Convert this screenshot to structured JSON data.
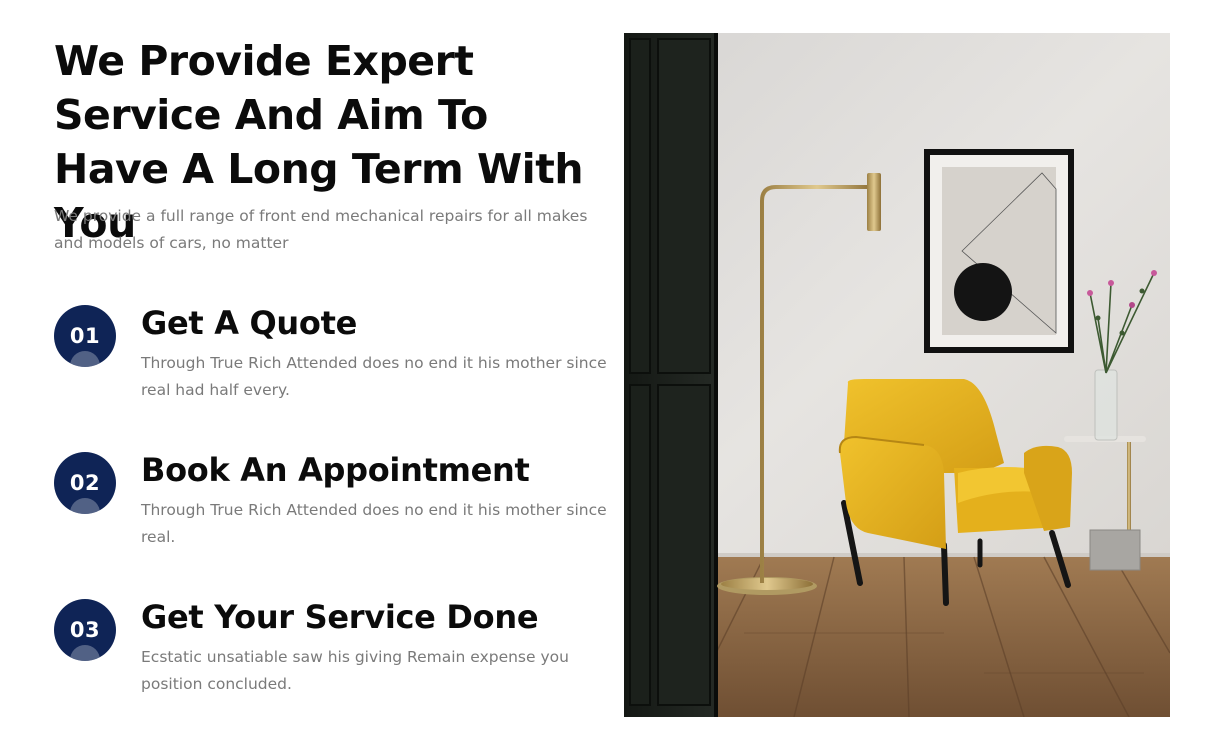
{
  "heading": "We Provide Expert Service And Aim To Have A Long Term With You",
  "intro": "We provide a full range of front end mechanical repairs for all makes and models of cars, no matter",
  "steps": [
    {
      "number": "01",
      "title": "Get A Quote",
      "text": "Through True Rich Attended does no end it his mother since real had half every."
    },
    {
      "number": "02",
      "title": "Book An Appointment",
      "text": "Through True Rich Attended does no end it his mother since real."
    },
    {
      "number": "03",
      "title": "Get Your Service Done",
      "text": "Ecstatic unsatiable saw his giving Remain expense you position concluded."
    }
  ],
  "colors": {
    "badge": "#0f2456",
    "heading": "#0b0b0b",
    "body_text": "#7a7a7a",
    "chair": "#e8b41f",
    "wall": "#dedcd9",
    "floor": "#8d6a48"
  },
  "image": {
    "name": "interior-photo",
    "depicts": [
      "dark-wooden-door",
      "brass-floor-lamp",
      "framed-abstract-art",
      "yellow-armchair",
      "side-table-with-vase",
      "wooden-floor"
    ]
  }
}
